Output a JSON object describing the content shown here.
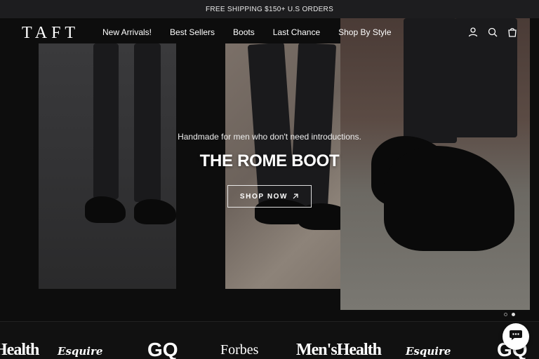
{
  "announcement": {
    "text": "FREE SHIPPING $150+ U.S ORDERS"
  },
  "header": {
    "logo": "TAFT",
    "nav": [
      {
        "label": "New Arrivals!"
      },
      {
        "label": "Best Sellers"
      },
      {
        "label": "Boots"
      },
      {
        "label": "Last Chance"
      },
      {
        "label": "Shop By Style"
      }
    ],
    "icons": [
      "account-icon",
      "search-icon",
      "cart-icon"
    ]
  },
  "hero": {
    "tagline": "Handmade for men who don't need introductions.",
    "title": "THE ROME BOOT",
    "cta": "SHOP NOW",
    "slides_total": 2,
    "active_slide": 2
  },
  "press": {
    "logos": [
      "Health",
      "Esquire",
      "GQ",
      "Forbes",
      "Men'sHealth",
      "Esquire",
      "GQ"
    ]
  },
  "colors": {
    "background": "#111111",
    "text": "#ffffff",
    "announcement_bg": "#1d1d1f"
  }
}
